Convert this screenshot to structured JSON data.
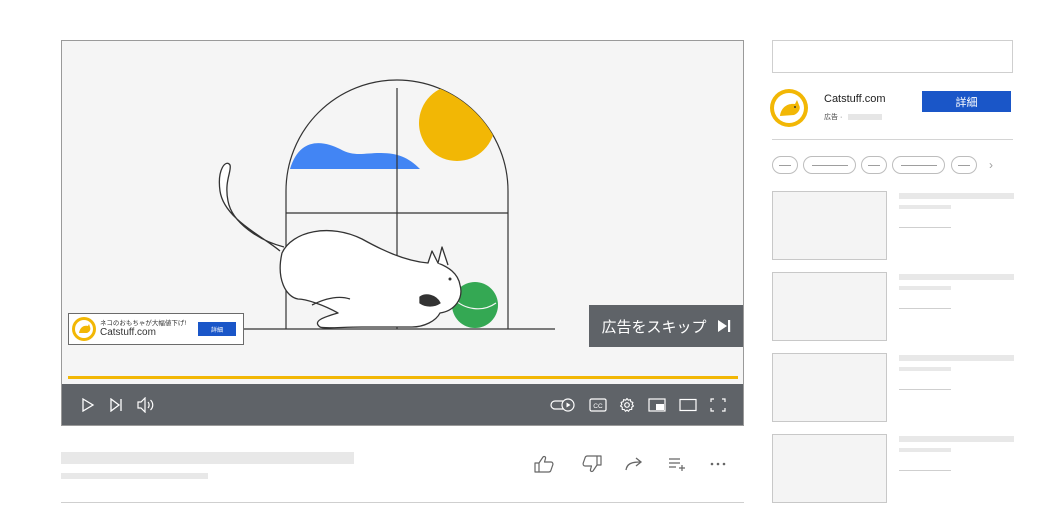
{
  "player": {
    "overlay_ad": {
      "headline": "ネコのおもちゃが大幅値下げ!",
      "domain": "Catstuff.com",
      "cta": "詳細"
    },
    "skip_ad_label": "広告をスキップ",
    "progress_fraction": 1.0,
    "controls": [
      "play-icon",
      "next-icon",
      "volume-icon",
      "autoplay-toggle-icon",
      "captions-icon",
      "settings-icon",
      "miniplayer-icon",
      "theater-mode-icon",
      "fullscreen-icon"
    ],
    "captions_label": "CC"
  },
  "actions": [
    "like-icon",
    "dislike-icon",
    "share-icon",
    "save-to-playlist-icon",
    "more-icon"
  ],
  "sidebar": {
    "ad": {
      "advertiser": "Catstuff.com",
      "label": "広告 ·",
      "cta": "詳細"
    },
    "chips_next": "›"
  },
  "colors": {
    "accent_yellow": "#f2b705",
    "cta_blue": "#1a56c8",
    "control_bar": "#5f6368",
    "sky_blue": "#4285f4",
    "ball_green": "#34a853"
  }
}
